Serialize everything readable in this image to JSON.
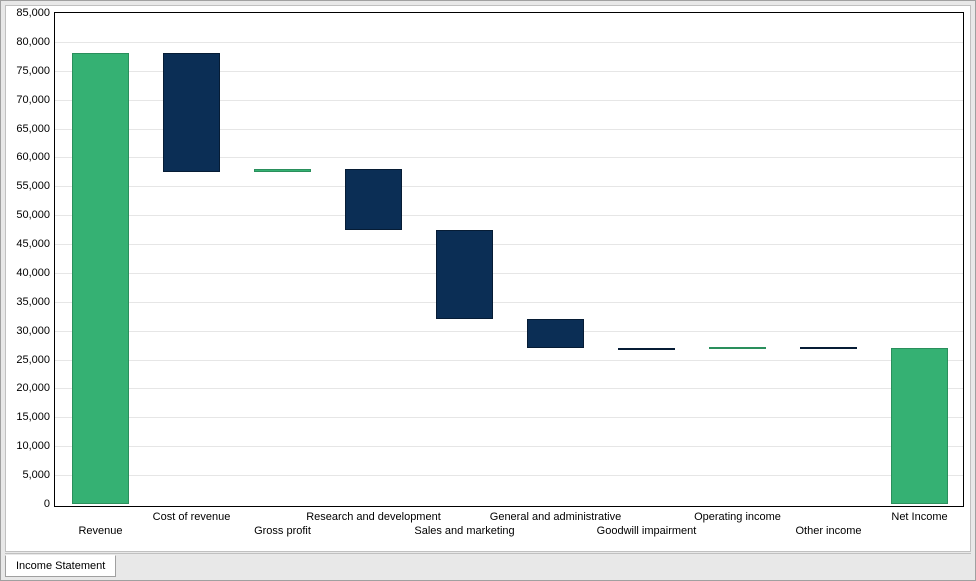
{
  "chart_data": {
    "type": "bar",
    "subtype": "waterfall",
    "ylim": [
      0,
      85000
    ],
    "y_tick_interval": 5000,
    "y_ticks": [
      0,
      5000,
      10000,
      15000,
      20000,
      25000,
      30000,
      35000,
      40000,
      45000,
      50000,
      55000,
      60000,
      65000,
      70000,
      75000,
      80000,
      85000
    ],
    "categories": [
      "Revenue",
      "Cost of revenue",
      "Gross profit",
      "Research and development",
      "Sales and marketing",
      "General and administrative",
      "Goodwill impairment",
      "Operating income",
      "Other income",
      "Net Income"
    ],
    "items": [
      {
        "label": "Revenue",
        "delta": 78000,
        "kind": "total",
        "start": 0,
        "end": 78000
      },
      {
        "label": "Cost of revenue",
        "delta": -20500,
        "kind": "neg",
        "start": 78000,
        "end": 57500
      },
      {
        "label": "Gross profit",
        "delta": 500,
        "kind": "pos",
        "start": 57500,
        "end": 58000
      },
      {
        "label": "Research and development",
        "delta": -10500,
        "kind": "neg",
        "start": 58000,
        "end": 47500
      },
      {
        "label": "Sales and marketing",
        "delta": -15500,
        "kind": "neg",
        "start": 47500,
        "end": 32000
      },
      {
        "label": "General and administrative",
        "delta": -5000,
        "kind": "neg",
        "start": 32000,
        "end": 27000
      },
      {
        "label": "Goodwill impairment",
        "delta": -200,
        "kind": "neg",
        "start": 27000,
        "end": 26800
      },
      {
        "label": "Operating income",
        "delta": 300,
        "kind": "pos",
        "start": 26800,
        "end": 27100
      },
      {
        "label": "Other income",
        "delta": -100,
        "kind": "neg",
        "start": 27100,
        "end": 27000
      },
      {
        "label": "Net Income",
        "delta": 27000,
        "kind": "total",
        "start": 0,
        "end": 27000
      }
    ],
    "colors": {
      "total": "#35b173",
      "pos": "#35b173",
      "neg": "#0b2e55"
    }
  },
  "tabs": {
    "active": "Income Statement"
  }
}
